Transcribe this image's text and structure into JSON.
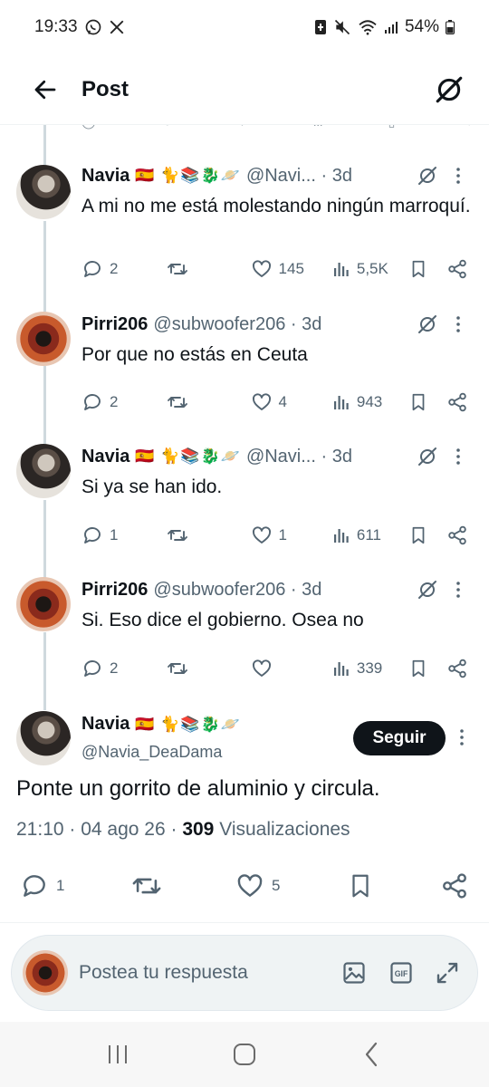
{
  "status_bar": {
    "time": "19:33",
    "battery": "54%"
  },
  "header": {
    "title": "Post"
  },
  "replies": [
    {
      "name": "Navia",
      "emojis": "🇪🇸 🐈📚🐉🪐",
      "handle": "@Navi... · 3d",
      "text": "A mi no me está molestando ningún marroquí.",
      "replies": "2",
      "reposts": "",
      "likes": "145",
      "views": "5,5K"
    },
    {
      "name": "Pirri206",
      "emojis": "",
      "handle": "@subwoofer206 · 3d",
      "text": "Por que no estás en Ceuta",
      "replies": "2",
      "reposts": "",
      "likes": "4",
      "views": "943"
    },
    {
      "name": "Navia",
      "emojis": "🇪🇸 🐈📚🐉🪐",
      "handle": "@Navi... · 3d",
      "text": "Si ya se han ido.",
      "replies": "1",
      "reposts": "",
      "likes": "1",
      "views": "611"
    },
    {
      "name": "Pirri206",
      "emojis": "",
      "handle": "@subwoofer206 · 3d",
      "text": "Si. Eso dice el gobierno. Osea no",
      "replies": "2",
      "reposts": "",
      "likes": "",
      "views": "339"
    }
  ],
  "main_post": {
    "name": "Navia",
    "emojis": "🇪🇸 🐈📚🐉🪐",
    "handle": "@Navia_DeaDama",
    "follow_label": "Seguir",
    "text": "Ponte un gorrito de aluminio y circula.",
    "time": "21:10 · 04 ago 26 · ",
    "views_count": "309",
    "views_label": " Visualizaciones",
    "replies": "1",
    "reposts": "",
    "likes": "5"
  },
  "reply_bar": {
    "placeholder": "Postea tu respuesta"
  },
  "colors": {
    "text_primary": "#0f1419",
    "text_secondary": "#536471",
    "thread_line": "#cfd9de",
    "follow_button": "#0f1419"
  }
}
